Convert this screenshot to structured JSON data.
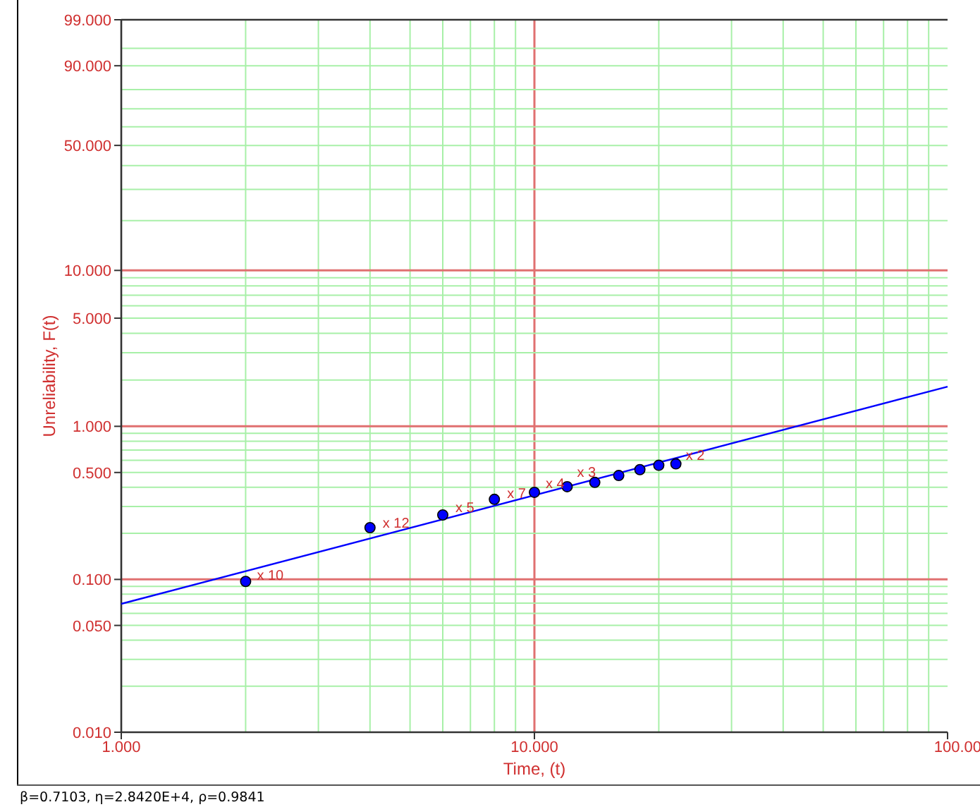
{
  "chart": {
    "x_axis_title": "Time, (t)",
    "y_axis_title": "Unreliability, F(t)",
    "x_tick_labels": [
      "1.000",
      "10.000",
      "100.00"
    ],
    "y_tick_labels": [
      "99.000",
      "90.000",
      "50.000",
      "10.000",
      "5.000",
      "1.000",
      "0.500",
      "0.100",
      "0.050",
      "0.010"
    ],
    "point_labels": [
      "x 10",
      "x 12",
      "x 5",
      "x 7",
      "x 4",
      "x 3",
      "x 2"
    ]
  },
  "status_bar": {
    "text": "β=0.7103, η=2.8420E+4, ρ=0.9841"
  }
}
